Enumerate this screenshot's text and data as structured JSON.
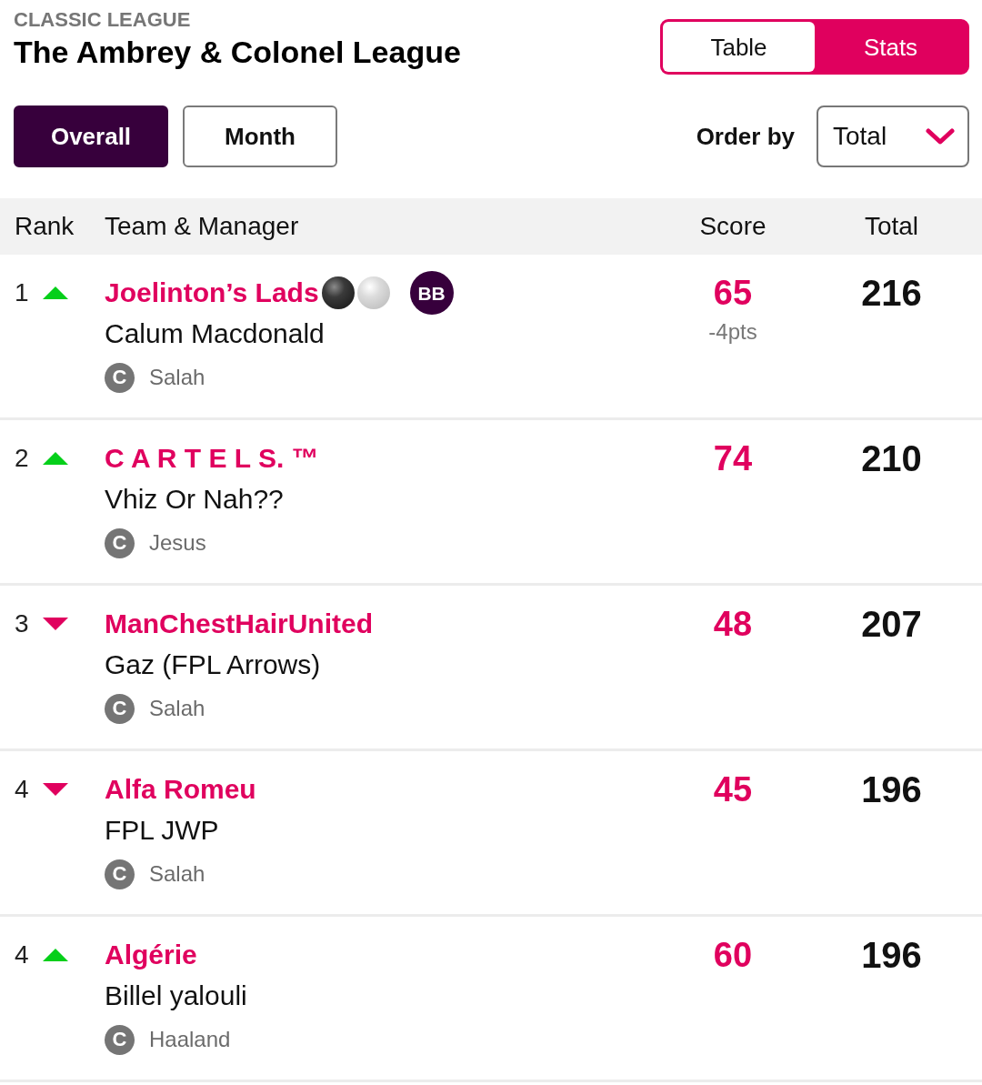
{
  "league": {
    "kind_label": "CLASSIC LEAGUE",
    "title": "The Ambrey & Colonel League"
  },
  "view_toggle": [
    {
      "label": "Table",
      "selected": true
    },
    {
      "label": "Stats",
      "selected": false
    }
  ],
  "period_tabs": [
    {
      "label": "Overall",
      "selected": true
    },
    {
      "label": "Month",
      "selected": false
    }
  ],
  "order_by": {
    "label": "Order by",
    "value": "Total"
  },
  "table": {
    "columns": [
      "Rank",
      "Team & Manager",
      "Score",
      "Total"
    ],
    "rows": [
      {
        "rank": "1",
        "rising": true,
        "team": "Joelinton’s Lads",
        "team_emoji": [
          {
            "kind": "dark"
          },
          {
            "kind": "light"
          }
        ],
        "chip": "BB",
        "manager": "Calum Macdonald",
        "captain_mark": "C",
        "captain": "Salah",
        "score": "65",
        "deduction": "-4pts",
        "total": "216"
      },
      {
        "rank": "2",
        "rising": true,
        "team": "C A R T E L S. ™",
        "manager": "Vhiz Or Nah??",
        "captain_mark": "C",
        "captain": "Jesus",
        "score": "74",
        "total": "210"
      },
      {
        "rank": "3",
        "rising": false,
        "team": "ManChestHairUnited",
        "manager": "Gaz (FPL Arrows)",
        "captain_mark": "C",
        "captain": "Salah",
        "score": "48",
        "total": "207"
      },
      {
        "rank": "4",
        "rising": false,
        "team": "Alfa Romeu",
        "manager": "FPL JWP",
        "captain_mark": "C",
        "captain": "Salah",
        "score": "45",
        "total": "196"
      },
      {
        "rank": "4",
        "rising": true,
        "team": "Algérie",
        "manager": "Billel yalouli",
        "captain_mark": "C",
        "captain": "Haaland",
        "score": "60",
        "total": "196"
      }
    ]
  }
}
